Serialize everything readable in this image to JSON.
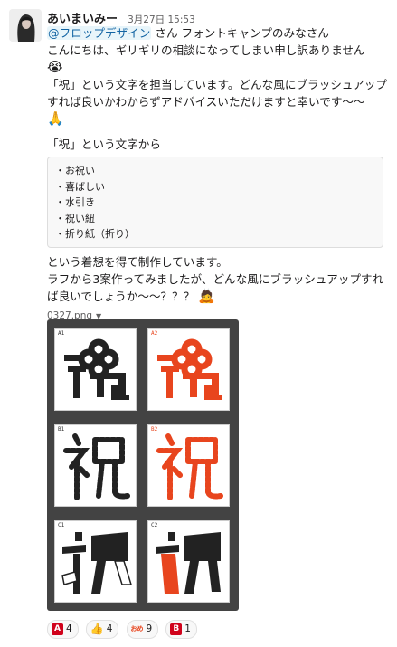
{
  "message": {
    "author": "あいまいみー",
    "timestamp": "3月27日 15:53",
    "mention": "@フロップデザイン",
    "line1_rest": " さん フォントキャンプのみなさん",
    "line2": "こんにちは、ギリギリの相談になってしまい申し訳ありません",
    "line3_emoji": "😭",
    "line4": "「祝」という文字を担当しています。どんな風にブラッシュアップ",
    "line5": "すれば良いかわからずアドバイスいただけますと幸いです〜〜",
    "line6_emoji": "🙏",
    "line7": "「祝」という文字から",
    "list_items": [
      "・お祝い",
      "・喜ばしい",
      "・水引き",
      "・祝い紐",
      "・折り紙（折り）"
    ],
    "line8": "という着想を得て制作しています。",
    "line9": "ラフから3案作ってみましたが、どんな風にブラッシュアップすれ",
    "line10": "ば良いでしょうか〜〜？？？",
    "line10_emoji": "🙇"
  },
  "attachment": {
    "filename": "0327.png",
    "tiles": [
      {
        "label": "A1",
        "label_color": "#333333"
      },
      {
        "label": "A2",
        "label_color": "#e8451e"
      },
      {
        "label": "B1",
        "label_color": "#333333"
      },
      {
        "label": "B2",
        "label_color": "#e8451e"
      },
      {
        "label": "C1",
        "label_color": "#333333"
      },
      {
        "label": "C2",
        "label_color": "#333333"
      }
    ]
  },
  "reactions": [
    {
      "icon": "a-button-icon",
      "symbol": "A",
      "count": "4"
    },
    {
      "icon": "thumbs-up-icon",
      "symbol": "👍",
      "count": "4"
    },
    {
      "icon": "omedetou-stamp-icon",
      "symbol": "おめ",
      "count": "9"
    },
    {
      "icon": "b-button-icon",
      "symbol": "B",
      "count": "1"
    }
  ],
  "colors": {
    "accent_red": "#e8451e",
    "mention_bg": "#e8f5fa",
    "mention_text": "#1264a3",
    "preview_bg": "#434343"
  }
}
